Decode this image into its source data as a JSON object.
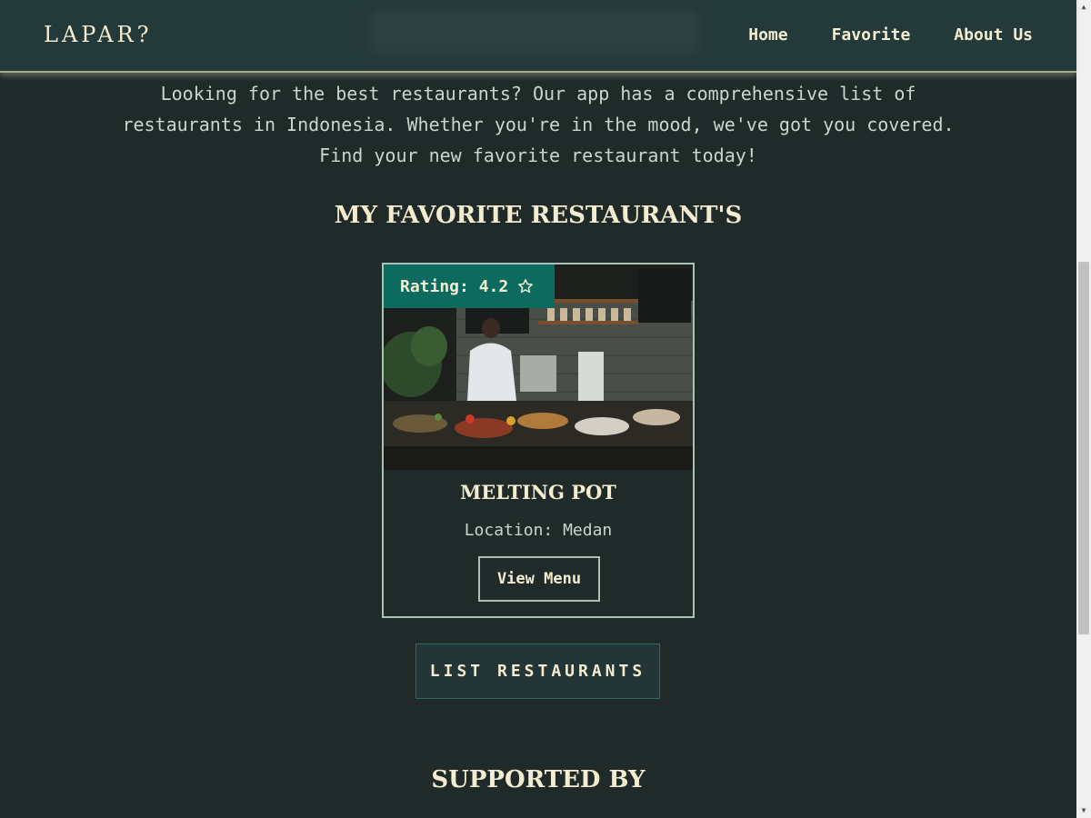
{
  "header": {
    "logo": "LAPAR?",
    "nav": [
      "Home",
      "Favorite",
      "About Us"
    ]
  },
  "intro": {
    "text": "Looking for the best restaurants? Our app has a comprehensive list of restaurants in Indonesia. Whether you're in the mood, we've got you covered. Find your new favorite restaurant today!"
  },
  "favorites": {
    "title": "MY FAVORITE RESTAURANT'S",
    "cards": [
      {
        "rating_label": "Rating: 4.2",
        "rating_icon": "star-outline-icon",
        "name": "MELTING POT",
        "location": "Location: Medan",
        "button_label": "View Menu"
      }
    ]
  },
  "list_button": {
    "label": "LIST RESTAURANTS"
  },
  "supported": {
    "title": "SUPPORTED BY"
  },
  "colors": {
    "background": "#1f2a29",
    "header": "#24393a",
    "accent": "#0c6a5f",
    "text_light": "#f3ecd0"
  }
}
